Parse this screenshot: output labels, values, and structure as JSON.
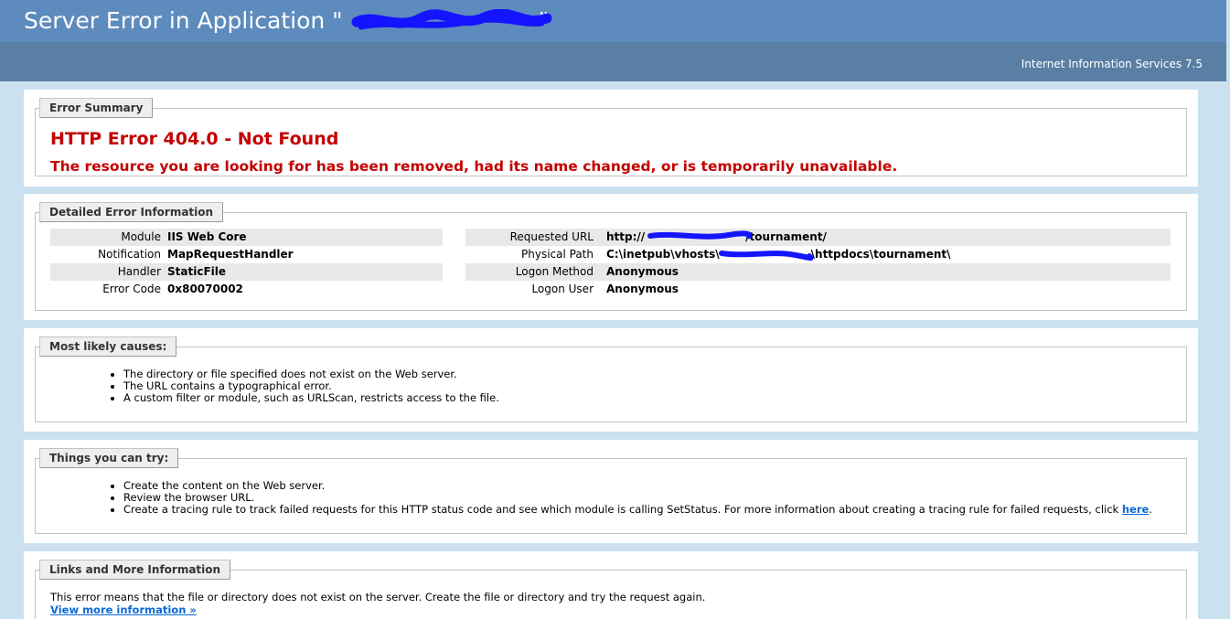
{
  "header": {
    "title": "Server Error in Application \"",
    "title_suffix": "\"",
    "iis_version": "Internet Information Services 7.5"
  },
  "error_summary": {
    "legend": "Error Summary",
    "heading": "HTTP Error 404.0 - Not Found",
    "message": "The resource you are looking for has been removed, had its name changed, or is temporarily unavailable."
  },
  "detailed": {
    "legend": "Detailed Error Information",
    "left_rows": [
      {
        "label": "Module",
        "value": "IIS Web Core"
      },
      {
        "label": "Notification",
        "value": "MapRequestHandler"
      },
      {
        "label": "Handler",
        "value": "StaticFile"
      },
      {
        "label": "Error Code",
        "value": "0x80070002"
      }
    ],
    "right_rows": [
      {
        "label": "Requested URL",
        "value_start": "http://",
        "value_end": "/tournament/"
      },
      {
        "label": "Physical Path",
        "value_start": "C:\\inetpub\\vhosts\\",
        "value_end": "\\httpdocs\\tournament\\"
      },
      {
        "label": "Logon Method",
        "value": "Anonymous"
      },
      {
        "label": "Logon User",
        "value": "Anonymous"
      }
    ]
  },
  "causes": {
    "legend": "Most likely causes:",
    "items": [
      "The directory or file specified does not exist on the Web server.",
      "The URL contains a typographical error.",
      "A custom filter or module, such as URLScan, restricts access to the file."
    ]
  },
  "try": {
    "legend": "Things you can try:",
    "items": [
      "Create the content on the Web server.",
      "Review the browser URL."
    ],
    "tracing_text": "Create a tracing rule to track failed requests for this HTTP status code and see which module is calling SetStatus. For more information about creating a tracing rule for failed requests, click ",
    "here_link": "here",
    "tracing_end": "."
  },
  "links": {
    "legend": "Links and More Information",
    "text": "This error means that the file or directory does not exist on the server. Create the file or directory and try the request again.",
    "view_more": "View more information »"
  },
  "colors": {
    "header_top": "#5d8bbd",
    "header_bar": "#5a7fa5",
    "page_background": "#cbe1ef",
    "error_red": "#c40000",
    "link_blue": "#0a6ad7",
    "redaction_blue": "#1414ff"
  }
}
